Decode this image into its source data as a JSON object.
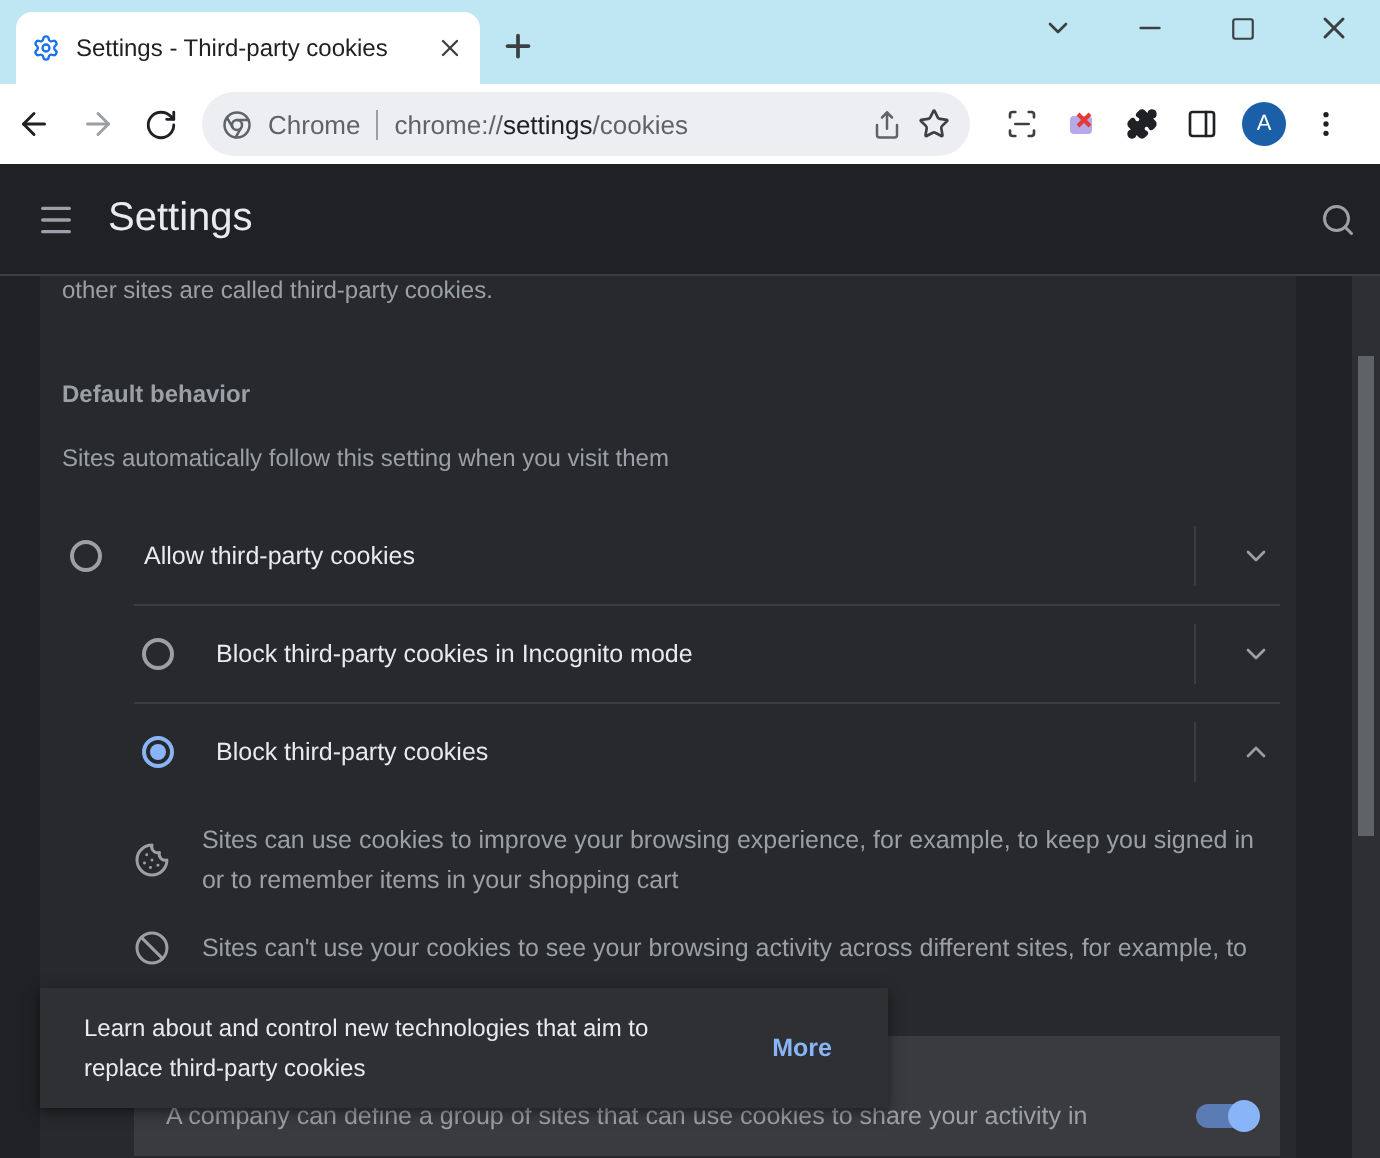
{
  "tab": {
    "title": "Settings - Third-party cookies",
    "selected": true
  },
  "omnibox": {
    "chip": "Chrome",
    "url_host": "chrome://",
    "url_path": "settings",
    "url_rest": "/cookies"
  },
  "profile": {
    "initial": "A"
  },
  "header": {
    "title": "Settings"
  },
  "intro_tail": "other sites are called third-party cookies.",
  "section": {
    "title": "Default behavior",
    "subtitle": "Sites automatically follow this setting when you visit them"
  },
  "options": [
    {
      "label": "Allow third-party cookies",
      "selected": false,
      "expanded": false
    },
    {
      "label": "Block third-party cookies in Incognito mode",
      "selected": false,
      "expanded": false
    },
    {
      "label": "Block third-party cookies",
      "selected": true,
      "expanded": true
    }
  ],
  "details": [
    {
      "kind": "cookie",
      "text": "Sites can use cookies to improve your browsing experience, for example, to keep you signed in or to remember items in your shopping cart"
    },
    {
      "kind": "blocked",
      "text": "Sites can't use your cookies to see your browsing activity across different sites, for example, to"
    }
  ],
  "fps": {
    "text": "A company can define a group of sites that can use cookies to share your activity in",
    "on": true
  },
  "toast": {
    "message": "Learn about and control new technologies that aim to replace third-party cookies",
    "action": "More"
  }
}
